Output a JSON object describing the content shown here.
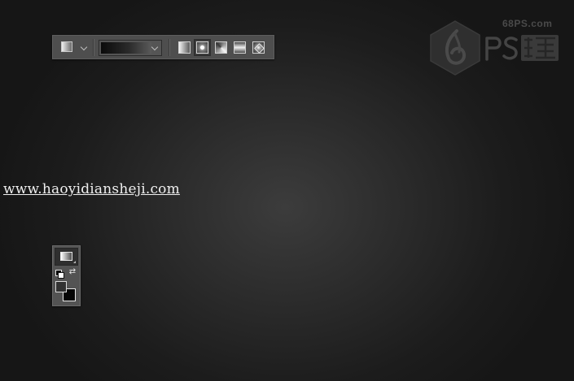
{
  "watermark": {
    "site": "68PS.com",
    "brand": "PS联盟"
  },
  "overlay": {
    "url": "www.haoyidiansheji.com"
  },
  "options_bar": {
    "preset_icon": "gradient-tool-icon",
    "gradient_preview": "black-to-dark-gray gradient",
    "styles": [
      "linear",
      "radial",
      "angle",
      "reflected",
      "diamond"
    ],
    "selected_style": "radial"
  },
  "tools_panel": {
    "active_tool": "gradient-tool",
    "foreground_color": "#323232",
    "background_color": "#050505"
  },
  "colors": {
    "canvas_center": "#3c3c3c",
    "canvas_edge": "#161616",
    "panel_bg": "#4e4e4e"
  }
}
